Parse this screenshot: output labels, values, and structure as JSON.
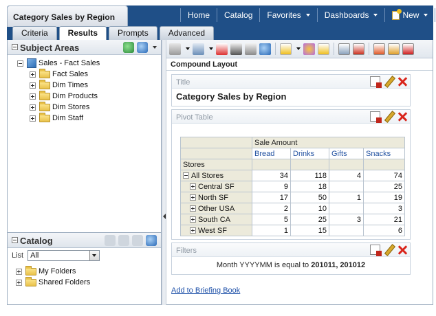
{
  "app": {
    "title": "Category Sales by Region",
    "nav": [
      "Home",
      "Catalog",
      "Favorites",
      "Dashboards",
      "New"
    ],
    "tabs": [
      "Criteria",
      "Results",
      "Prompts",
      "Advanced"
    ],
    "active_tab": "Results"
  },
  "subject_areas": {
    "title": "Subject Areas",
    "root": "Sales - Fact Sales",
    "items": [
      "Fact Sales",
      "Dim Times",
      "Dim Products",
      "Dim Stores",
      "Dim Staff"
    ]
  },
  "catalog": {
    "title": "Catalog",
    "list_label": "List",
    "list_value": "All",
    "items": [
      "My Folders",
      "Shared Folders"
    ]
  },
  "layout": {
    "header": "Compound Layout",
    "title_view": {
      "label": "Title",
      "text": "Category Sales by Region"
    },
    "pivot_view": {
      "label": "Pivot Table",
      "measure": "Sale Amount",
      "columns": [
        "Bread",
        "Drinks",
        "Gifts",
        "Snacks"
      ],
      "row_header": "Stores",
      "rows": [
        {
          "label": "All Stores",
          "values": [
            "34",
            "118",
            "4",
            "74"
          ]
        },
        {
          "label": "Central SF",
          "values": [
            "9",
            "18",
            "",
            "25"
          ]
        },
        {
          "label": "North SF",
          "values": [
            "17",
            "50",
            "1",
            "19"
          ]
        },
        {
          "label": "Other USA",
          "values": [
            "2",
            "10",
            "",
            "3"
          ]
        },
        {
          "label": "South CA",
          "values": [
            "5",
            "25",
            "3",
            "21"
          ]
        },
        {
          "label": "West SF",
          "values": [
            "1",
            "15",
            "",
            "6"
          ]
        }
      ]
    },
    "filters_view": {
      "label": "Filters",
      "text": "Month YYYYMM is equal to",
      "value": "201011, 201012"
    },
    "briefing_link": "Add to Briefing Book"
  },
  "colors": {
    "header_bar": "#1f4f87",
    "link": "#1c4fa8",
    "pivot_header_bg": "#eceadb",
    "delete_red": "#d9251b"
  }
}
